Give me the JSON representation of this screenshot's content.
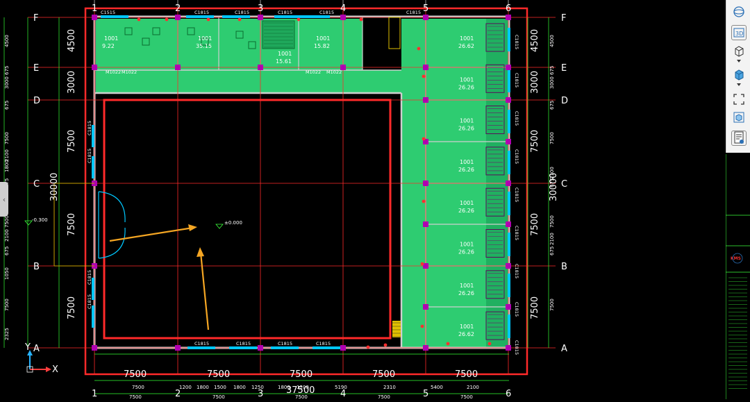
{
  "app": {
    "name": "CAD floor-plan viewer"
  },
  "grid": {
    "columns": [
      "1",
      "2",
      "3",
      "4",
      "5",
      "6"
    ],
    "rows": [
      "F",
      "E",
      "D",
      "C",
      "B",
      "A"
    ]
  },
  "dims": {
    "bottom_spans": [
      "7500",
      "7500",
      "7500",
      "7500",
      "7500"
    ],
    "bottom_total": "37500",
    "bottom_sub": [
      "7500",
      "1200",
      "1800",
      "1500",
      "1800",
      "1250",
      "1800",
      "1200",
      "5190",
      "2310",
      "5400",
      "2100"
    ],
    "bottom_sub2": [
      "7500",
      "7500",
      "7500",
      "7500",
      "7500"
    ],
    "left_spans": [
      "4500",
      "3000",
      "7500",
      "7500",
      "7500"
    ],
    "left_total": "30000",
    "right_spans": [
      "4500",
      "3000",
      "7500",
      "7500",
      "7500"
    ],
    "right_total": "30000",
    "left_small": [
      "4500",
      "675",
      "3000",
      "675",
      "7500",
      "2100",
      "1800",
      "675",
      "7500",
      "2100",
      "675",
      "1050",
      "7500",
      "2325"
    ],
    "right_small": [
      "4500",
      "675",
      "3000",
      "675",
      "7500",
      "2100",
      "675",
      "7500",
      "2100",
      "675",
      "7500"
    ],
    "top_win_labels": [
      "C1515",
      "C1815",
      "C1815",
      "C1815",
      "C1815",
      "C1815",
      "C1815",
      "C1815",
      "C1815"
    ],
    "right_win_labels": [
      "C1815",
      "C1815",
      "C1815",
      "C1815",
      "C1815",
      "C1815",
      "C1815",
      "C1815",
      "C1815"
    ],
    "bottom_win_labels": [
      "C1815",
      "C1815",
      "C1815",
      "C1815"
    ],
    "left_win_labels": [
      "C1815",
      "C1815",
      "C1815",
      "C1815"
    ],
    "door_labels": [
      "M1022",
      "M1022",
      "M1022",
      "M1022"
    ],
    "room_top": [
      {
        "code": "1001",
        "area": "9.22"
      },
      {
        "code": "1001",
        "area": "35.15"
      },
      {
        "code": "1001",
        "area": "15.61"
      },
      {
        "code": "1001",
        "area": "15.82"
      }
    ],
    "room_right": [
      {
        "code": "1001",
        "area": "26.62"
      },
      {
        "code": "1001",
        "area": "26.26"
      },
      {
        "code": "1001",
        "area": "26.26"
      },
      {
        "code": "1001",
        "area": "26.26"
      },
      {
        "code": "1001",
        "area": "26.26"
      },
      {
        "code": "1001",
        "area": "26.26"
      },
      {
        "code": "1001",
        "area": "26.26"
      },
      {
        "code": "1001",
        "area": "26.62"
      }
    ]
  },
  "level_marks": [
    "±0.000",
    "-0.300"
  ],
  "axes_icon": {
    "x": "X",
    "y": "Y"
  },
  "logo": {
    "text": "KMS"
  },
  "colors": {
    "room_fill": "#2ecc71",
    "grid_red": "#ff2a2a",
    "outline_red": "#ff2a2a",
    "wall": "#cfcfcf",
    "dim_green": "#33ff33",
    "arrow": "#f5a623",
    "column": "#b000b0",
    "window": "#00c8ff"
  },
  "toolbar": {
    "icons": [
      "orbit-icon",
      "3d-view-icon",
      "cube-view-icon",
      "dropdown-icon",
      "solid-cube-icon",
      "dropdown-icon",
      "fit-view-icon",
      "section-box-icon",
      "properties-icon"
    ]
  }
}
